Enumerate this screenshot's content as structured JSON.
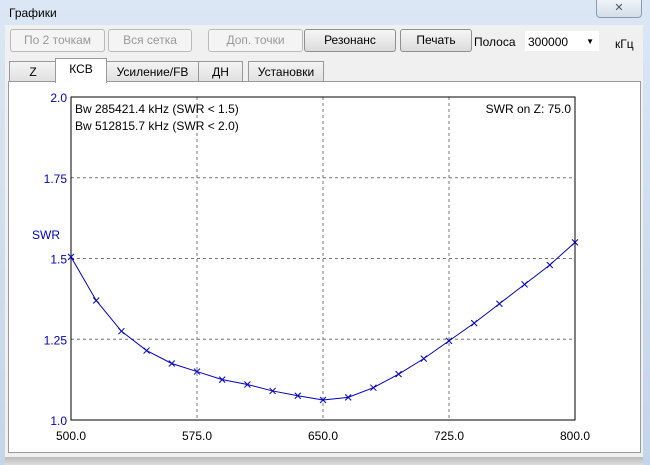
{
  "window": {
    "title": "Графики",
    "close_icon": "✕"
  },
  "toolbar": {
    "btn_two_points": "По 2 точкам",
    "btn_all_grid": "Вся сетка",
    "btn_extra_points": "Доп. точки",
    "btn_resonance": "Резонанс",
    "btn_print": "Печать",
    "band_label": "Полоса",
    "band_value": "300000",
    "band_unit": "кГц"
  },
  "tabs": [
    {
      "label": "Z"
    },
    {
      "label": "КСВ"
    },
    {
      "label": "Усиление/FB"
    },
    {
      "label": "ДН"
    },
    {
      "label": "Установки"
    }
  ],
  "chart_data": {
    "type": "line",
    "ylabel": "SWR",
    "xlim": [
      500,
      800
    ],
    "ylim": [
      1.0,
      2.0
    ],
    "xticks": [
      "500.0",
      "575.0",
      "650.0",
      "725.0",
      "800.0"
    ],
    "yticks": [
      "1.0",
      "1.25",
      "1.5",
      "1.75",
      "2.0"
    ],
    "grid": true,
    "annotations": [
      "Bw 285421.4 kHz (SWR < 1.5)",
      "Bw 512815.7 kHz (SWR < 2.0)",
      "SWR on Z: 75.0"
    ],
    "x": [
      500,
      515,
      530,
      545,
      560,
      575,
      590,
      605,
      620,
      635,
      650,
      665,
      680,
      695,
      710,
      725,
      740,
      755,
      770,
      785,
      800
    ],
    "series": [
      {
        "name": "SWR",
        "color": "#0000c0",
        "values": [
          1.505,
          1.37,
          1.275,
          1.215,
          1.175,
          1.15,
          1.125,
          1.11,
          1.09,
          1.075,
          1.062,
          1.07,
          1.1,
          1.142,
          1.19,
          1.245,
          1.3,
          1.36,
          1.42,
          1.48,
          1.55
        ]
      }
    ]
  }
}
